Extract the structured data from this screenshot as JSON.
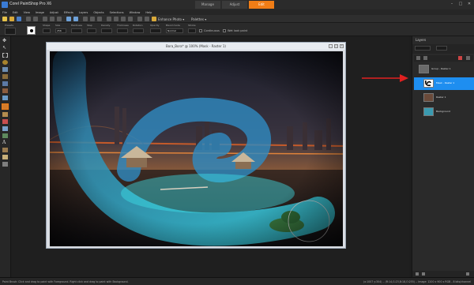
{
  "app": {
    "title": "Corel PaintShop Pro X6"
  },
  "tabs": [
    {
      "label": "Manage"
    },
    {
      "label": "Adjust"
    },
    {
      "label": "Edit"
    }
  ],
  "window_controls": [
    "–",
    "□",
    "✕"
  ],
  "menu": [
    "File",
    "Edit",
    "View",
    "Image",
    "Adjust",
    "Effects",
    "Layers",
    "Objects",
    "Selections",
    "Window",
    "Help"
  ],
  "toolbar": {
    "enhance_photo": "Enhance Photo ▾",
    "palettes": "Palettes ▾"
  },
  "tool_options": {
    "labels": [
      "Presets",
      "Shape",
      "Size",
      "Hardness",
      "Step",
      "Density",
      "Thickness",
      "Rotation",
      "Opacity",
      "Blend mode",
      "Stroke"
    ],
    "size_value": "256",
    "blend_mode": "Normal",
    "continuous": "Continuous",
    "wet_look": "Wet look paint"
  },
  "image_window": {
    "title": "Bora_Bora* @ 100% (Mask - Raster 1)"
  },
  "layers": {
    "title": "Layers",
    "items": [
      {
        "name": "Group - Raster 1"
      },
      {
        "name": "Mask - Raster 1"
      },
      {
        "name": "Raster 1"
      },
      {
        "name": "Background"
      }
    ]
  },
  "status": {
    "left": "Paint Brush: Click and drag to paint with Foreground. Right click and drag to paint with Background.",
    "right": "(x:1007 y:304) -- (R:14,G:23,B:18,O:255) -- Image:  1200 x 900 x RGB - 8 bits/channel"
  },
  "colors": {
    "accent": "#f07d16",
    "selection": "#1e8ef0",
    "arrow": "#e02020"
  }
}
